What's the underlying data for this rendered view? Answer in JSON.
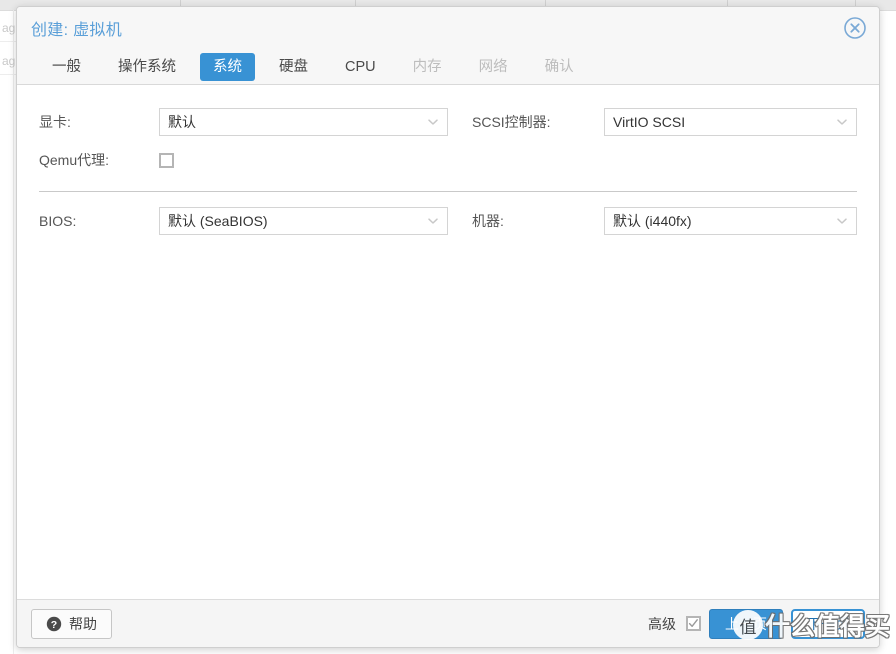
{
  "background": {
    "row_labels": [
      "ag",
      "ag"
    ]
  },
  "dialog": {
    "title": "创建: 虚拟机",
    "close_icon": "close-circle-icon",
    "tabs": [
      {
        "label": "一般",
        "state": "normal"
      },
      {
        "label": "操作系统",
        "state": "normal"
      },
      {
        "label": "系统",
        "state": "active"
      },
      {
        "label": "硬盘",
        "state": "normal"
      },
      {
        "label": "CPU",
        "state": "normal"
      },
      {
        "label": "内存",
        "state": "disabled"
      },
      {
        "label": "网络",
        "state": "disabled"
      },
      {
        "label": "确认",
        "state": "disabled"
      }
    ],
    "form": {
      "graphic_card": {
        "label": "显卡:",
        "value": "默认",
        "icon": "chevron-down-icon"
      },
      "qemu_agent": {
        "label": "Qemu代理:",
        "checked": false
      },
      "scsi_controller": {
        "label": "SCSI控制器:",
        "value": "VirtIO SCSI",
        "icon": "chevron-down-icon"
      },
      "bios": {
        "label": "BIOS:",
        "value": "默认 (SeaBIOS)",
        "icon": "chevron-down-icon"
      },
      "machine": {
        "label": "机器:",
        "value": "默认 (i440fx)",
        "icon": "chevron-down-icon"
      }
    },
    "footer": {
      "help_label": "帮助",
      "help_icon": "question-mark-circle-icon",
      "advanced_label": "高级",
      "advanced_checked": true,
      "back_label": "上一页",
      "next_label": "下一页"
    }
  },
  "watermark": {
    "badge": "值",
    "text": "什么值得买"
  },
  "colors": {
    "accent": "#3892d4",
    "title_text": "#5a9fd8",
    "border": "#d4d4d4",
    "footer_bg": "#f5f5f5",
    "disabled_tab": "#bdbdbd"
  }
}
